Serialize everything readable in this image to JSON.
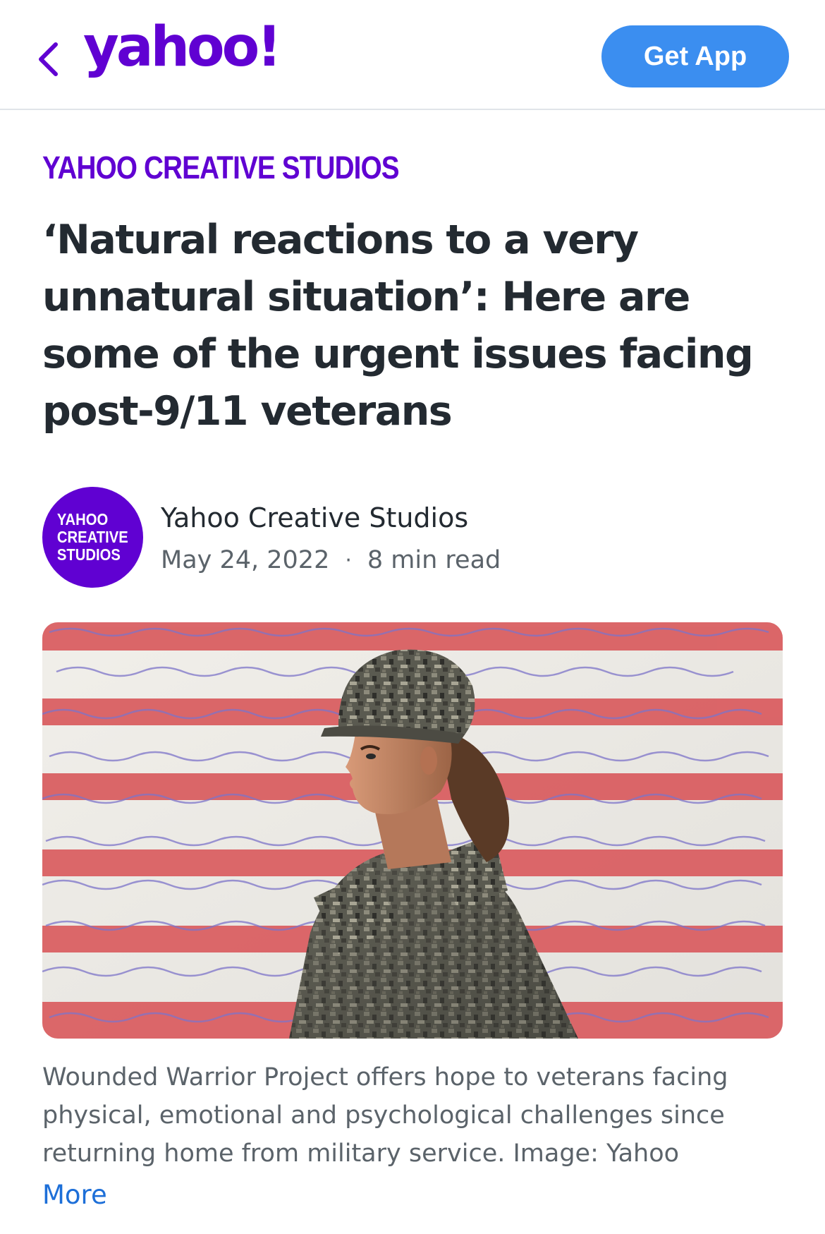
{
  "header": {
    "back_icon": "chevron-left-icon",
    "logo_text": "yahoo!",
    "get_app_label": "Get App"
  },
  "article": {
    "section": "YAHOO CREATIVE STUDIOS",
    "headline": "‘Natural reactions to a very unnatural situation’: Here are some of the urgent issues facing post-9/11 veterans",
    "author": {
      "avatar_lines": [
        "YAHOO",
        "CREATIVE",
        "STUDIOS"
      ],
      "name": "Yahoo Creative Studios",
      "date": "May 24, 2022",
      "read_time": "8 min read"
    },
    "image": {
      "caption": "Wounded Warrior Project offers hope to veterans facing physical, emotional and psychological challenges since returning home from military service. Image: Yahoo",
      "more_label": "More"
    }
  },
  "colors": {
    "brand_purple": "#6001d2",
    "button_blue": "#3b8ef0",
    "link_blue": "#1d6fd8",
    "stripe_red": "#d9595c",
    "text_dark": "#232a31",
    "text_gray": "#5b636a"
  }
}
